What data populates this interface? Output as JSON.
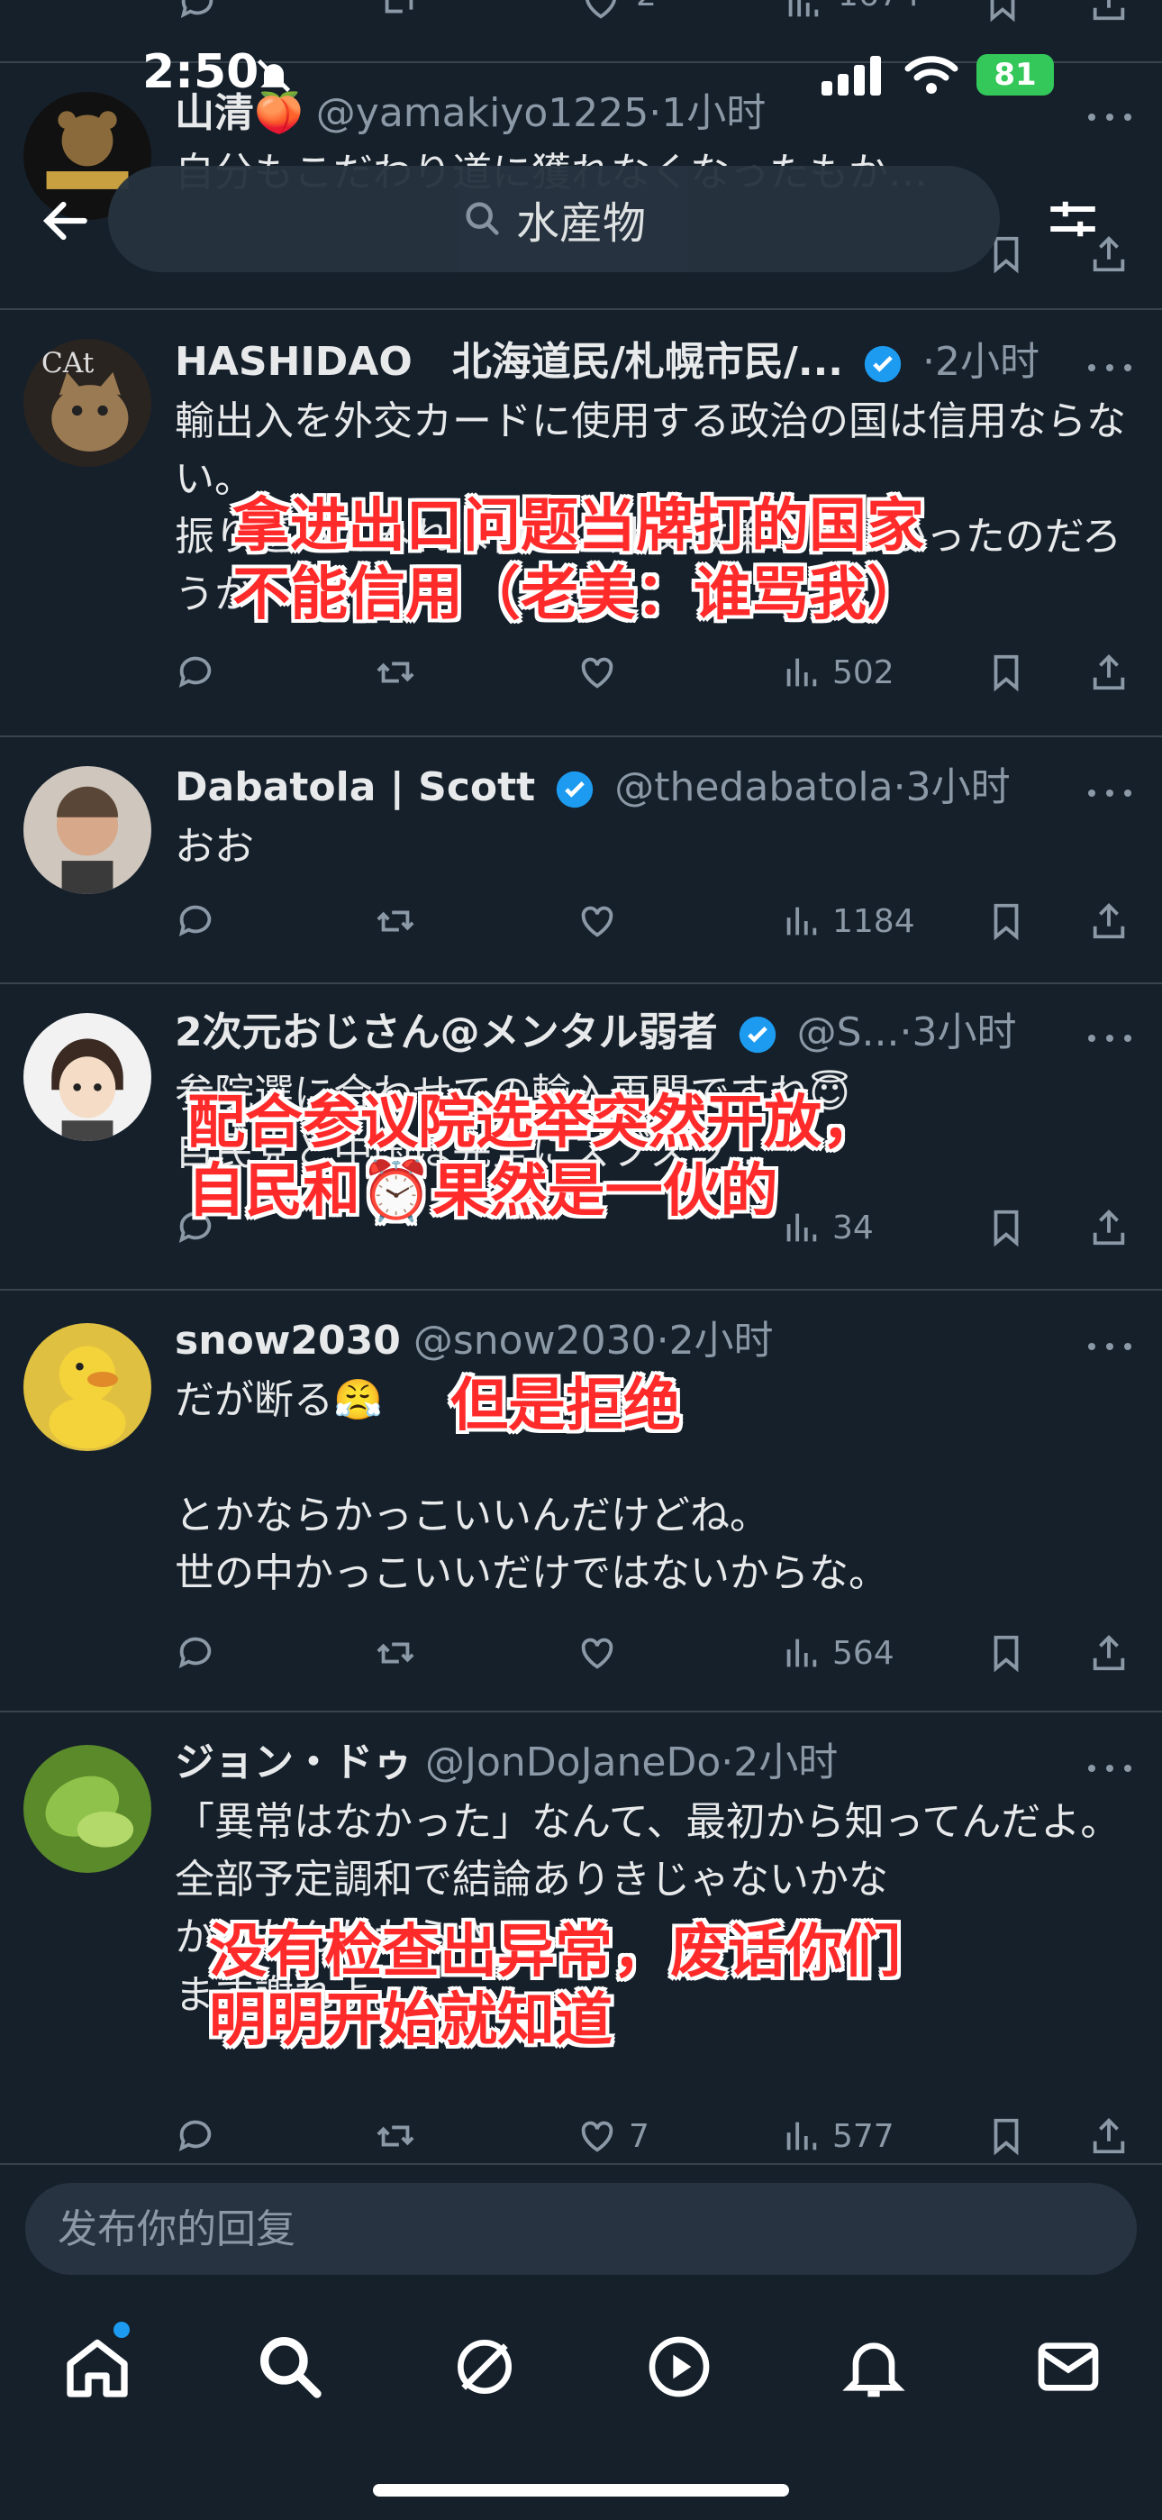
{
  "status_bar": {
    "time": "2:50",
    "battery": "81"
  },
  "search": {
    "query": "水産物"
  },
  "top_tweet_stub": {
    "likes": "2",
    "views": "1674"
  },
  "tweets": [
    {
      "name": "山清🍑",
      "handle": "@yamakiyo1225",
      "time": "1小时",
      "body": "自分もこだわり道に獲れなくなったもか…",
      "verified": false
    },
    {
      "name": "HASHIDAO　北海道民/札幌市民/...",
      "handle": "",
      "time": "2小时",
      "body": "輸出入を外交カードに使用する政治の国は信用ならない。\n振り返ってみれば日本の外交政策は正しかったのだろうか？",
      "verified": true,
      "views": "502",
      "overlay": [
        "拿进出口问题当牌打的国家",
        "不能信用（老美：谁骂我）"
      ]
    },
    {
      "name": "Dabatola | Scott",
      "handle": "@thedabatola",
      "time": "3小时",
      "body": "おお",
      "verified": true,
      "views": "1184"
    },
    {
      "name": "2次元おじさん@メンタル弱者",
      "handle": "@S...",
      "time": "3小时",
      "body": "参院選に合わせての輸入再開ですね😇\n自民党と中国は完全にズブズブ...",
      "verified": true,
      "views": "34",
      "overlay": [
        "配合参议院选举突然开放，",
        "自民和⏰果然是一伙的"
      ]
    },
    {
      "name": "snow2030",
      "handle": "@snow2030",
      "time": "2小时",
      "body": "だが断る😤\n\nとかならかっこいいんだけどね。\n世の中かっこいいだけではないからな。",
      "verified": false,
      "views": "564",
      "overlay": [
        "但是拒绝"
      ]
    },
    {
      "name": "ジョン・ドゥ",
      "handle": "@JonDoJaneDo",
      "time": "2小时",
      "body": "「異常はなかった」なんて、最初から知ってんだよ。\n全部予定調和で結論ありきじゃないかな\nかったんだからさ\nます謝れよ。",
      "verified": false,
      "likes": "7",
      "views": "577",
      "overlay": [
        "没有检查出异常，废话你们",
        "明明开始就知道"
      ]
    }
  ],
  "reply": {
    "placeholder": "发布你的回复"
  },
  "tabs": [
    "home",
    "search",
    "grok",
    "video",
    "notifications",
    "messages"
  ],
  "colors": {
    "background": "#15202b",
    "accent": "#1d9bf0",
    "muted": "#8b98a5",
    "overlay_text": "#ff2a2a",
    "battery": "#34c759"
  }
}
